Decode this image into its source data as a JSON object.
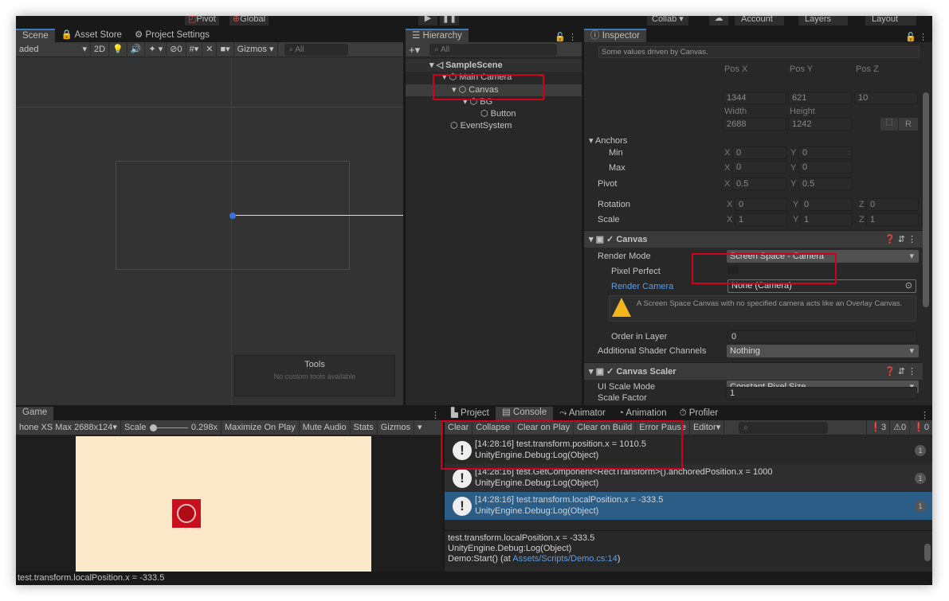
{
  "toolbar": {
    "pivot": "Pivot",
    "global": "Global",
    "collab": "Collab",
    "account": "Account",
    "layers": "Layers",
    "layout": "Layout"
  },
  "scene": {
    "tabs": [
      "Scene",
      "Asset Store",
      "Project Settings"
    ],
    "shading": "aded",
    "mode_2d": "2D",
    "hidden_count": "0",
    "gizmos": "Gizmos",
    "search_placeholder": "All",
    "tools_title": "Tools",
    "tools_msg": "No custom tools available"
  },
  "hierarchy": {
    "tab": "Hierarchy",
    "search_placeholder": "All",
    "items": [
      "SampleScene",
      "Main Camera",
      "Canvas",
      "BG",
      "Button",
      "EventSystem"
    ]
  },
  "inspector": {
    "tab": "Inspector",
    "note": "Some values driven by Canvas.",
    "rect": {
      "pos_x_label": "Pos X",
      "pos_y_label": "Pos Y",
      "pos_z_label": "Pos Z",
      "pos_x": "1344",
      "pos_y": "621",
      "pos_z": "10",
      "width_label": "Width",
      "height_label": "Height",
      "width": "2688",
      "height": "1242",
      "r_button": "R",
      "anchors": "Anchors",
      "min": "Min",
      "max": "Max",
      "pivot": "Pivot",
      "rotation": "Rotation",
      "scale": "Scale",
      "min_x": "0",
      "min_y": "0",
      "max_x": "0",
      "max_y": "0",
      "pivot_x": "0.5",
      "pivot_y": "0.5",
      "rot_x": "0",
      "rot_y": "0",
      "rot_z": "0",
      "scale_x": "1",
      "scale_y": "1",
      "scale_z": "1"
    },
    "canvas": {
      "title": "Canvas",
      "render_mode_label": "Render Mode",
      "render_mode": "Screen Space - Camera",
      "pixel_perfect": "Pixel Perfect",
      "render_camera_label": "Render Camera",
      "render_camera": "None (Camera)",
      "warning": "A Screen Space Canvas with no specified camera acts like an Overlay Canvas.",
      "order_label": "Order in Layer",
      "order": "0",
      "shader_label": "Additional Shader Channels",
      "shader": "Nothing"
    },
    "scaler": {
      "title": "Canvas Scaler",
      "mode_label": "UI Scale Mode",
      "mode": "Constant Pixel Size",
      "factor_label": "Scale Factor",
      "factor": "1"
    }
  },
  "game": {
    "tab": "Game",
    "resolution": "hone XS Max 2688x124",
    "scale_label": "Scale",
    "scale_value": "0.298x",
    "maximize": "Maximize On Play",
    "mute": "Mute Audio",
    "stats": "Stats",
    "gizmos": "Gizmos",
    "bg_color": "#fbe8c8",
    "button_color": "#c8101e"
  },
  "console": {
    "tabs": [
      "Project",
      "Console",
      "Animator",
      "Animation",
      "Profiler"
    ],
    "buttons": [
      "Clear",
      "Collapse",
      "Clear on Play",
      "Clear on Build",
      "Error Pause",
      "Editor"
    ],
    "log_count": "3",
    "warn_count": "0",
    "error_count": "0",
    "rows": [
      {
        "line1": "[14:28:16] test.transform.position.x = 1010.5",
        "line2": "UnityEngine.Debug:Log(Object)",
        "count": "1"
      },
      {
        "line1": "[14:28:16] test.GetComponent<RectTransform>().anchoredPosition.x = 1000",
        "line2": "UnityEngine.Debug:Log(Object)",
        "count": "1"
      },
      {
        "line1": "[14:28:16] test.transform.localPosition.x = -333.5",
        "line2": "UnityEngine.Debug:Log(Object)",
        "count": "1"
      }
    ],
    "detail": {
      "line1": "test.transform.localPosition.x = -333.5",
      "line2": "UnityEngine.Debug:Log(Object)",
      "line3_prefix": "Demo:Start() (at ",
      "line3_link": "Assets/Scripts/Demo.cs:14",
      "line3_suffix": ")"
    }
  },
  "status": "test.transform.localPosition.x = -333.5"
}
